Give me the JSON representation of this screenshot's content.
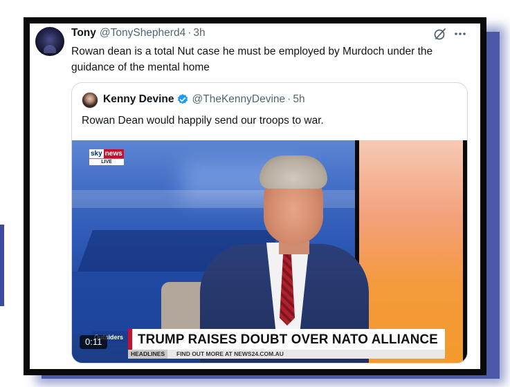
{
  "tweet": {
    "author_name": "Tony",
    "author_handle": "@TonyShepherd4",
    "separator": "·",
    "time": "3h",
    "text": "Rowan dean is a total Nut case he must be employed by Murdoch under the guidance of the mental home",
    "icons": [
      "grok-icon",
      "more-icon",
      "avatar"
    ]
  },
  "quoted_tweet": {
    "author_name": "Kenny Devine",
    "verified": true,
    "author_handle": "@TheKennyDevine",
    "separator": "·",
    "time": "5h",
    "text": "Rowan Dean would happily send our troops to war."
  },
  "video": {
    "duration": "0:11",
    "channel_logo": {
      "sky": "sky",
      "news": "news",
      "live": "LIVE"
    },
    "show_tag": "Outsiders",
    "headline": "TRUMP RAISES DOUBT OVER NATO ALLIANCE",
    "ticker_label": "HEADLINES",
    "ticker_text": "FIND OUT MORE AT NEWS24.COM.AU"
  },
  "colors": {
    "frame": "#0a0a0a",
    "shadow": "#4a5aa8",
    "verified_badge": "#1d9bf0",
    "text_primary": "#0f1419",
    "text_secondary": "#536471"
  }
}
